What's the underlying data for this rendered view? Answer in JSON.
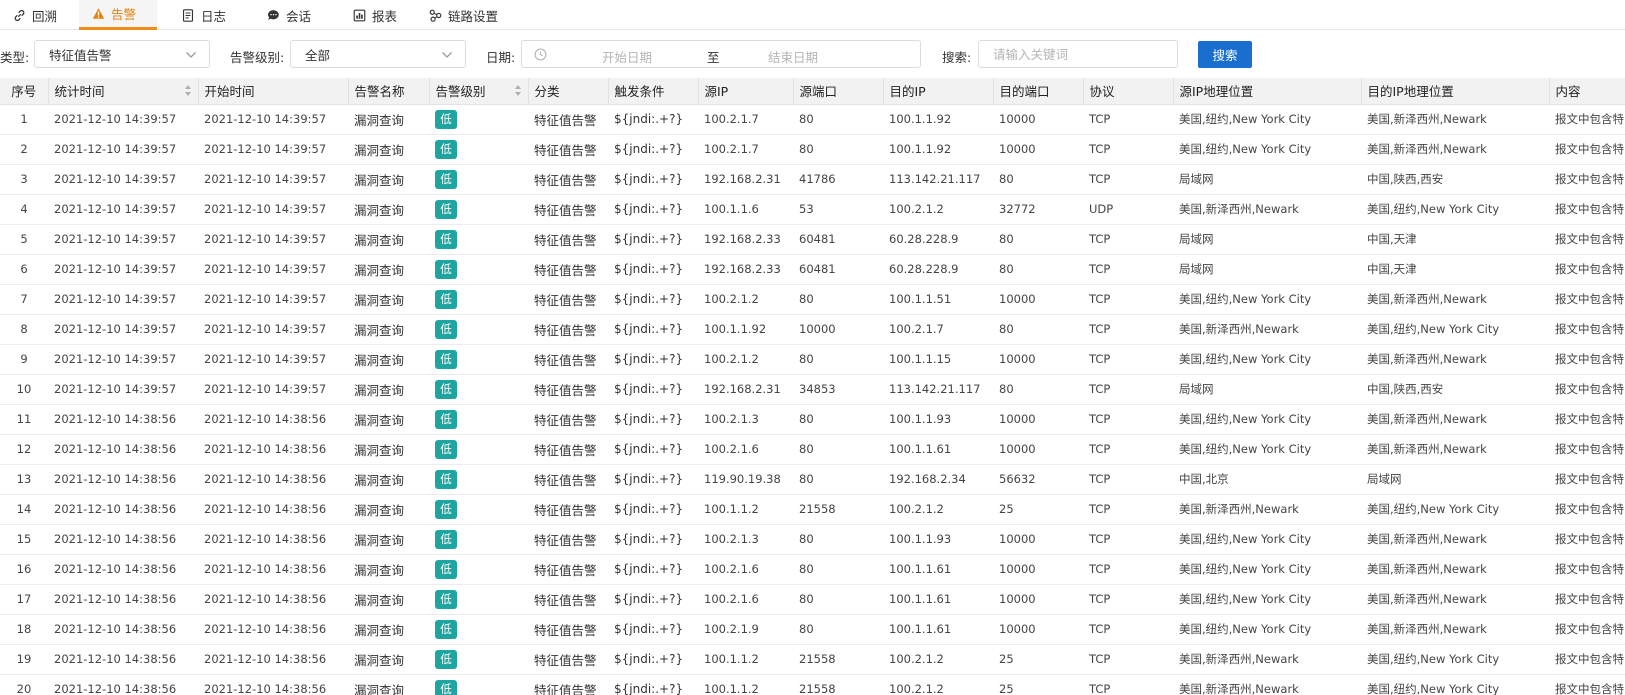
{
  "tabs": [
    {
      "label": "回溯",
      "icon": "link-icon"
    },
    {
      "label": "告警",
      "icon": "warning-icon"
    },
    {
      "label": "日志",
      "icon": "document-icon"
    },
    {
      "label": "会话",
      "icon": "chat-icon"
    },
    {
      "label": "报表",
      "icon": "report-icon"
    },
    {
      "label": "链路设置",
      "icon": "chain-link-icon"
    }
  ],
  "active_tab": "告警",
  "colors": {
    "accent": "#f08c14",
    "primary": "#1a6fce",
    "level_low": "#1fa5a0"
  },
  "filters": {
    "type_label": "类型:",
    "type_value": "特征值告警",
    "level_label": "告警级别:",
    "level_value": "全部",
    "date_label": "日期:",
    "date_start_placeholder": "开始日期",
    "date_sep": "至",
    "date_end_placeholder": "结束日期",
    "search_label": "搜索:",
    "search_placeholder": "请输入关键词",
    "search_button": "搜索"
  },
  "table": {
    "columns": [
      "序号",
      "统计时间",
      "开始时间",
      "告警名称",
      "告警级别",
      "分类",
      "触发条件",
      "源IP",
      "源端口",
      "目的IP",
      "目的端口",
      "协议",
      "源IP地理位置",
      "目的IP地理位置",
      "内容"
    ],
    "rows": [
      [
        "1",
        "2021-12-10 14:39:57",
        "2021-12-10 14:39:57",
        "漏洞查询",
        "低",
        "特征值告警",
        "${jndi:.+?}",
        "100.2.1.7",
        "80",
        "100.1.1.92",
        "10000",
        "TCP",
        "美国,纽约,New York City",
        "美国,新泽西州,Newark",
        "报文中包含特"
      ],
      [
        "2",
        "2021-12-10 14:39:57",
        "2021-12-10 14:39:57",
        "漏洞查询",
        "低",
        "特征值告警",
        "${jndi:.+?}",
        "100.2.1.7",
        "80",
        "100.1.1.92",
        "10000",
        "TCP",
        "美国,纽约,New York City",
        "美国,新泽西州,Newark",
        "报文中包含特"
      ],
      [
        "3",
        "2021-12-10 14:39:57",
        "2021-12-10 14:39:57",
        "漏洞查询",
        "低",
        "特征值告警",
        "${jndi:.+?}",
        "192.168.2.31",
        "41786",
        "113.142.21.117",
        "80",
        "TCP",
        "局域网",
        "中国,陕西,西安",
        "报文中包含特"
      ],
      [
        "4",
        "2021-12-10 14:39:57",
        "2021-12-10 14:39:57",
        "漏洞查询",
        "低",
        "特征值告警",
        "${jndi:.+?}",
        "100.1.1.6",
        "53",
        "100.2.1.2",
        "32772",
        "UDP",
        "美国,新泽西州,Newark",
        "美国,纽约,New York City",
        "报文中包含特"
      ],
      [
        "5",
        "2021-12-10 14:39:57",
        "2021-12-10 14:39:57",
        "漏洞查询",
        "低",
        "特征值告警",
        "${jndi:.+?}",
        "192.168.2.33",
        "60481",
        "60.28.228.9",
        "80",
        "TCP",
        "局域网",
        "中国,天津",
        "报文中包含特"
      ],
      [
        "6",
        "2021-12-10 14:39:57",
        "2021-12-10 14:39:57",
        "漏洞查询",
        "低",
        "特征值告警",
        "${jndi:.+?}",
        "192.168.2.33",
        "60481",
        "60.28.228.9",
        "80",
        "TCP",
        "局域网",
        "中国,天津",
        "报文中包含特"
      ],
      [
        "7",
        "2021-12-10 14:39:57",
        "2021-12-10 14:39:57",
        "漏洞查询",
        "低",
        "特征值告警",
        "${jndi:.+?}",
        "100.2.1.2",
        "80",
        "100.1.1.51",
        "10000",
        "TCP",
        "美国,纽约,New York City",
        "美国,新泽西州,Newark",
        "报文中包含特"
      ],
      [
        "8",
        "2021-12-10 14:39:57",
        "2021-12-10 14:39:57",
        "漏洞查询",
        "低",
        "特征值告警",
        "${jndi:.+?}",
        "100.1.1.92",
        "10000",
        "100.2.1.7",
        "80",
        "TCP",
        "美国,新泽西州,Newark",
        "美国,纽约,New York City",
        "报文中包含特"
      ],
      [
        "9",
        "2021-12-10 14:39:57",
        "2021-12-10 14:39:57",
        "漏洞查询",
        "低",
        "特征值告警",
        "${jndi:.+?}",
        "100.2.1.2",
        "80",
        "100.1.1.15",
        "10000",
        "TCP",
        "美国,纽约,New York City",
        "美国,新泽西州,Newark",
        "报文中包含特"
      ],
      [
        "10",
        "2021-12-10 14:39:57",
        "2021-12-10 14:39:57",
        "漏洞查询",
        "低",
        "特征值告警",
        "${jndi:.+?}",
        "192.168.2.31",
        "34853",
        "113.142.21.117",
        "80",
        "TCP",
        "局域网",
        "中国,陕西,西安",
        "报文中包含特"
      ],
      [
        "11",
        "2021-12-10 14:38:56",
        "2021-12-10 14:38:56",
        "漏洞查询",
        "低",
        "特征值告警",
        "${jndi:.+?}",
        "100.2.1.3",
        "80",
        "100.1.1.93",
        "10000",
        "TCP",
        "美国,纽约,New York City",
        "美国,新泽西州,Newark",
        "报文中包含特"
      ],
      [
        "12",
        "2021-12-10 14:38:56",
        "2021-12-10 14:38:56",
        "漏洞查询",
        "低",
        "特征值告警",
        "${jndi:.+?}",
        "100.2.1.6",
        "80",
        "100.1.1.61",
        "10000",
        "TCP",
        "美国,纽约,New York City",
        "美国,新泽西州,Newark",
        "报文中包含特"
      ],
      [
        "13",
        "2021-12-10 14:38:56",
        "2021-12-10 14:38:56",
        "漏洞查询",
        "低",
        "特征值告警",
        "${jndi:.+?}",
        "119.90.19.38",
        "80",
        "192.168.2.34",
        "56632",
        "TCP",
        "中国,北京",
        "局域网",
        "报文中包含特"
      ],
      [
        "14",
        "2021-12-10 14:38:56",
        "2021-12-10 14:38:56",
        "漏洞查询",
        "低",
        "特征值告警",
        "${jndi:.+?}",
        "100.1.1.2",
        "21558",
        "100.2.1.2",
        "25",
        "TCP",
        "美国,新泽西州,Newark",
        "美国,纽约,New York City",
        "报文中包含特"
      ],
      [
        "15",
        "2021-12-10 14:38:56",
        "2021-12-10 14:38:56",
        "漏洞查询",
        "低",
        "特征值告警",
        "${jndi:.+?}",
        "100.2.1.3",
        "80",
        "100.1.1.93",
        "10000",
        "TCP",
        "美国,纽约,New York City",
        "美国,新泽西州,Newark",
        "报文中包含特"
      ],
      [
        "16",
        "2021-12-10 14:38:56",
        "2021-12-10 14:38:56",
        "漏洞查询",
        "低",
        "特征值告警",
        "${jndi:.+?}",
        "100.2.1.6",
        "80",
        "100.1.1.61",
        "10000",
        "TCP",
        "美国,纽约,New York City",
        "美国,新泽西州,Newark",
        "报文中包含特"
      ],
      [
        "17",
        "2021-12-10 14:38:56",
        "2021-12-10 14:38:56",
        "漏洞查询",
        "低",
        "特征值告警",
        "${jndi:.+?}",
        "100.2.1.6",
        "80",
        "100.1.1.61",
        "10000",
        "TCP",
        "美国,纽约,New York City",
        "美国,新泽西州,Newark",
        "报文中包含特"
      ],
      [
        "18",
        "2021-12-10 14:38:56",
        "2021-12-10 14:38:56",
        "漏洞查询",
        "低",
        "特征值告警",
        "${jndi:.+?}",
        "100.2.1.9",
        "80",
        "100.1.1.61",
        "10000",
        "TCP",
        "美国,纽约,New York City",
        "美国,新泽西州,Newark",
        "报文中包含特"
      ],
      [
        "19",
        "2021-12-10 14:38:56",
        "2021-12-10 14:38:56",
        "漏洞查询",
        "低",
        "特征值告警",
        "${jndi:.+?}",
        "100.1.1.2",
        "21558",
        "100.2.1.2",
        "25",
        "TCP",
        "美国,新泽西州,Newark",
        "美国,纽约,New York City",
        "报文中包含特"
      ],
      [
        "20",
        "2021-12-10 14:38:56",
        "2021-12-10 14:38:56",
        "漏洞查询",
        "低",
        "特征值告警",
        "${jndi:.+?}",
        "100.1.1.2",
        "21558",
        "100.2.1.2",
        "25",
        "TCP",
        "美国,新泽西州,Newark",
        "美国,纽约,New York City",
        "报文中包含特"
      ]
    ]
  }
}
